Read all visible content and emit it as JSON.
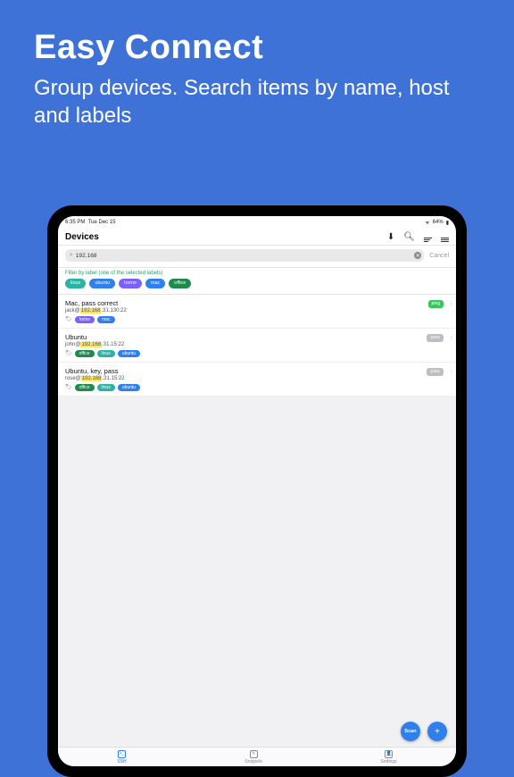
{
  "hero": {
    "title": "Easy Connect",
    "subtitle": "Group devices. Search items by name, host and labels"
  },
  "status": {
    "time": "6:35 PM",
    "date": "Tue Dec 15",
    "battery": "64%"
  },
  "navbar": {
    "title": "Devices"
  },
  "search": {
    "value": "192.168",
    "cancel": "Cancel"
  },
  "filter": {
    "hint": "Filter by label (one of the selected labels)",
    "chips": [
      {
        "label": "linux",
        "color": "#2bb3a3"
      },
      {
        "label": "ubuntu",
        "color": "#2f80ed"
      },
      {
        "label": "home",
        "color": "#7b61ff"
      },
      {
        "label": "mac",
        "color": "#2f80ed"
      },
      {
        "label": "office",
        "color": "#1f8a4c"
      }
    ]
  },
  "devices": [
    {
      "name": "Mac, pass correct",
      "user": "jack@",
      "host_hl": "192.168",
      "host_rest": ".31.130:22",
      "badge": "ping",
      "badge_style": "green",
      "tags": [
        {
          "t": "home",
          "c": "#7b61ff"
        },
        {
          "t": "mac",
          "c": "#2f80ed"
        }
      ]
    },
    {
      "name": "Ubuntu",
      "user": "john@",
      "host_hl": "192.168",
      "host_rest": ".31.15:22",
      "badge": "pass",
      "badge_style": "grey",
      "tags": [
        {
          "t": "office",
          "c": "#1f8a4c"
        },
        {
          "t": "linux",
          "c": "#2bb3a3"
        },
        {
          "t": "ubuntu",
          "c": "#2f80ed"
        }
      ]
    },
    {
      "name": "Ubuntu, key, pass",
      "user": "rose@",
      "host_hl": "192.168",
      "host_rest": ".31.15:22",
      "badge": "pass",
      "badge_style": "grey",
      "tags": [
        {
          "t": "office",
          "c": "#1f8a4c"
        },
        {
          "t": "linux",
          "c": "#2bb3a3"
        },
        {
          "t": "ubuntu",
          "c": "#2f80ed"
        }
      ]
    }
  ],
  "fab": {
    "scan": "Scan",
    "add": "+"
  },
  "tabs": [
    {
      "label": "SSH",
      "active": true
    },
    {
      "label": "Snippets",
      "active": false
    },
    {
      "label": "Settings",
      "active": false
    }
  ]
}
